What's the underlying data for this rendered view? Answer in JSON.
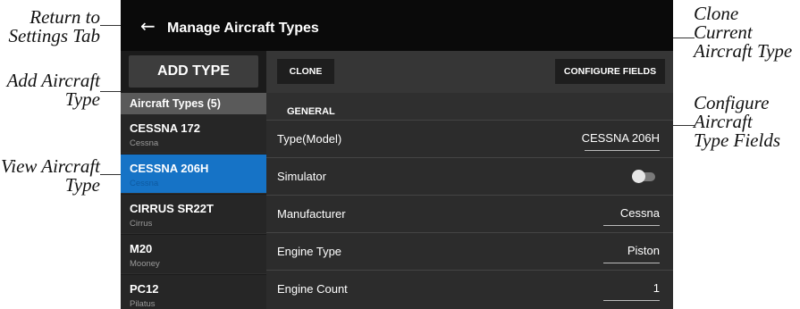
{
  "callouts": {
    "return_to_settings": [
      "Return to",
      "Settings Tab"
    ],
    "add_aircraft_type": [
      "Add Aircraft",
      "Type"
    ],
    "view_aircraft_type": [
      "View Aircraft",
      "Type"
    ],
    "clone_current": [
      "Clone",
      "Current",
      "Aircraft Type"
    ],
    "configure_fields": [
      "Configure",
      "Aircraft",
      "Type Fields"
    ]
  },
  "header": {
    "back_icon": "←",
    "title": "Manage Aircraft Types"
  },
  "sidebar": {
    "add_button": "ADD TYPE",
    "list_header": "Aircraft Types (5)",
    "items": [
      {
        "name": "CESSNA 172",
        "manufacturer": "Cessna",
        "selected": false
      },
      {
        "name": "CESSNA 206H",
        "manufacturer": "Cessna",
        "selected": true
      },
      {
        "name": "CIRRUS SR22T",
        "manufacturer": "Cirrus",
        "selected": false
      },
      {
        "name": "M20",
        "manufacturer": "Mooney",
        "selected": false
      },
      {
        "name": "PC12",
        "manufacturer": "Pilatus",
        "selected": false
      }
    ]
  },
  "toolbar": {
    "clone_label": "CLONE",
    "configure_label": "CONFIGURE FIELDS"
  },
  "detail": {
    "section": "GENERAL",
    "fields": [
      {
        "label": "Type(Model)",
        "value": "CESSNA 206H"
      },
      {
        "label": "Simulator",
        "toggle": "off"
      },
      {
        "label": "Manufacturer",
        "value": "Cessna"
      },
      {
        "label": "Engine Type",
        "value": "Piston"
      },
      {
        "label": "Engine Count",
        "value": "1"
      }
    ]
  },
  "colors": {
    "selected": "#1673c6",
    "header_bg": "#0a0a0a",
    "panel_bg": "#2c2c2c"
  }
}
